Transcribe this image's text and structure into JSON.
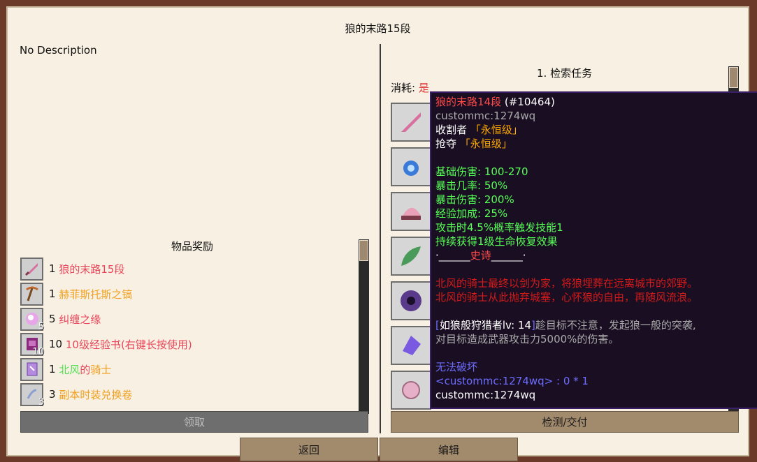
{
  "dialog": {
    "title": "狼的末路15段",
    "description": "No Description"
  },
  "rewards": {
    "header": "物品奖励",
    "items": [
      {
        "count": "1",
        "name": "狼的末路15段",
        "name_color": "#e8465a",
        "slot_count": "",
        "icon": "dagger-icon"
      },
      {
        "count": "1",
        "name": "赫菲斯托斯之镐",
        "name_color": "#f0a020",
        "slot_count": "",
        "icon": "pickaxe-icon"
      },
      {
        "count": "5",
        "name": "纠缠之缘",
        "name_color": "#e8465a",
        "slot_count": "5",
        "icon": "sparkle-orb-icon"
      },
      {
        "count": "10",
        "name": "10级经验书(右键长按使用)",
        "name_color": "#e8465a",
        "slot_count": "10",
        "icon": "book-icon"
      },
      {
        "count": "1",
        "name_a": "北风",
        "name_b": "的",
        "name_c": "骑士",
        "name_a_color": "#55dd55",
        "name_b_color": "#e8465a",
        "name_c_color": "#f0a020",
        "slot_count": "",
        "icon": "knight-card-icon"
      },
      {
        "count": "3",
        "name": "副本时装兑换卷",
        "name_color": "#f0a020",
        "slot_count": "3",
        "icon": "scroll-icon"
      }
    ],
    "claim_label": "领取"
  },
  "task": {
    "header": "1. 检索任务",
    "consume_label": "消耗:",
    "consume_value": "是",
    "slots": [
      "dagger-icon",
      "blue-orb-icon",
      "hat-icon",
      "feather-icon",
      "vortex-icon",
      "crystal-icon",
      "pink-orb-icon"
    ],
    "detect_label": "检测/交付"
  },
  "buttons": {
    "back": "返回",
    "edit": "编辑"
  },
  "tooltip": {
    "name": "狼的末路14段",
    "id": "(#10464)",
    "owner": "custommc:1274wq",
    "line_reaper_label": "收割者",
    "line_reaper_value": "「永恒级」",
    "line_plunder_label": "抢夺",
    "line_plunder_value": "「永恒级」",
    "stat1": "基础伤害:   100-270",
    "stat2": "暴击几率:   50%",
    "stat3": "暴击伤害:   200%",
    "stat4": "经验加成:   25%",
    "stat5": "攻击时4.5%概率触发技能1",
    "stat6": "持续获得1级生命恢复效果",
    "rarity_left": "·______",
    "rarity": "史诗",
    "rarity_right": "______·",
    "lore1": "北风的骑士最终以剑为家，将狼埋葬在远离城市的郊野。",
    "lore2": "北风的骑士从此抛弃城塞，心怀狼的自由，再随风流浪。",
    "skill_bracket_open": "[",
    "skill_name": "如狼般狩猎者lv:",
    "skill_level": "14",
    "skill_bracket_close": "]",
    "skill_desc1": "趁目标不注意，发起狼一般的突袭,",
    "skill_desc2": "对目标造成武器攻击力5000%的伤害。",
    "unbreakable": "无法破坏",
    "nbt": "<custommc:1274wq> : 0 * 1",
    "footer_owner": "custommc:1274wq"
  }
}
